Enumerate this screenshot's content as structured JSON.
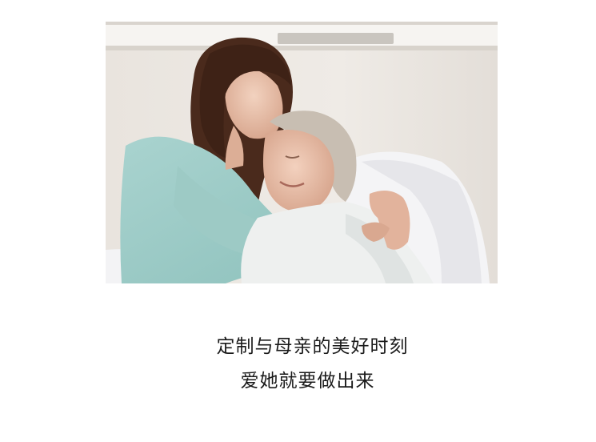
{
  "photo": {
    "subject": "photo-of-daughter-kissing-elderly-mother-forehead"
  },
  "caption": {
    "line1": "定制与母亲的美好时刻",
    "line2": "爱她就要做出来"
  },
  "colors": {
    "background": "#ffffff",
    "text": "#1a1a1a"
  }
}
